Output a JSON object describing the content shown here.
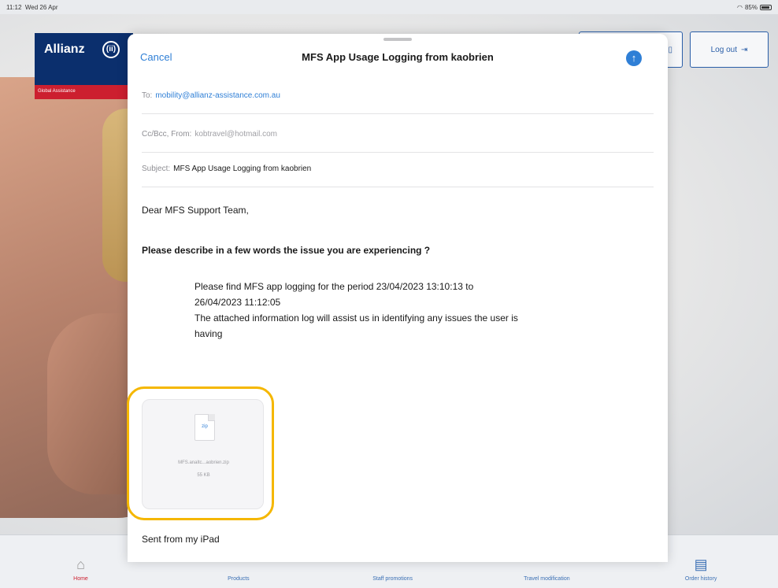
{
  "status_bar": {
    "time": "11:12",
    "date": "Wed 26 Apr",
    "battery": "85%"
  },
  "background_app": {
    "logo": {
      "name": "Allianz",
      "mark": "(ii)",
      "subline": "Global Assistance"
    },
    "logout_label": "Log out",
    "tabs": [
      {
        "label": "Home",
        "icon": "home-icon"
      },
      {
        "label": "Products",
        "icon": ""
      },
      {
        "label": "Staff promotions",
        "icon": ""
      },
      {
        "label": "Travel modification",
        "icon": ""
      },
      {
        "label": "Order history",
        "icon": "book-icon"
      }
    ]
  },
  "compose": {
    "cancel_label": "Cancel",
    "title": "MFS App Usage Logging from kaobrien",
    "to_label": "To:",
    "to_value": "mobility@allianz-assistance.com.au",
    "cc_label": "Cc/Bcc, From:",
    "cc_value": "kobtravel@hotmail.com",
    "subject_label": "Subject:",
    "subject_value": "MFS App Usage Logging from kaobrien",
    "greeting": "Dear MFS Support Team,",
    "question": "Please describe in a few words the issue you are experiencing ?",
    "paragraph_line1": "Please find MFS app logging for the period 23/04/2023 13:10:13 to",
    "paragraph_line2": "26/04/2023 11:12:05",
    "paragraph_line3": "The attached information log will assist us in identifying any issues the user is",
    "paragraph_line4": "having",
    "attachment": {
      "type_label": "zip",
      "name": "MFS.analtc...aobrien.zip",
      "size": "55 KB"
    },
    "signature": "Sent from my iPad"
  },
  "colors": {
    "accent": "#2f7fd6",
    "highlight": "#f5b700",
    "brand_navy": "#0b2f6d",
    "brand_red": "#cc1f2f"
  }
}
